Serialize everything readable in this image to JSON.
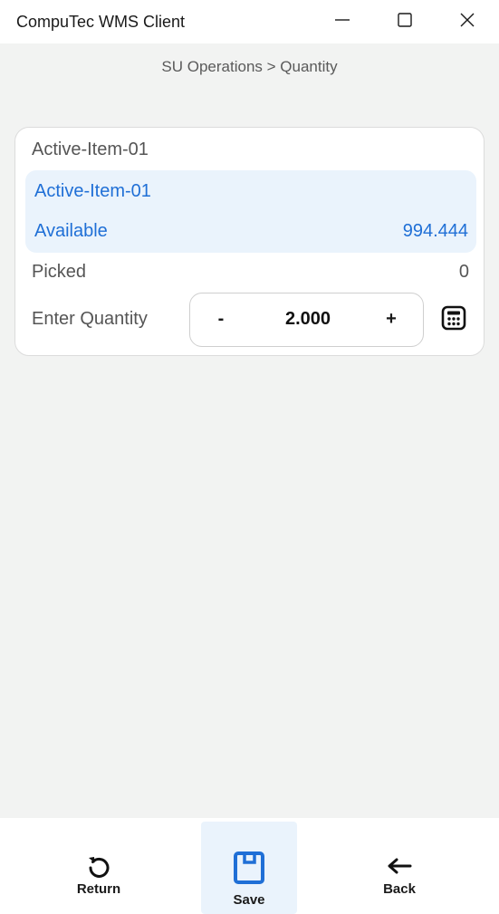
{
  "window": {
    "title": "CompuTec WMS Client"
  },
  "breadcrumb": "SU Operations > Quantity",
  "item": {
    "header": "Active-Item-01",
    "name": "Active-Item-01",
    "available_label": "Available",
    "available_value": "994.444",
    "picked_label": "Picked",
    "picked_value": "0",
    "quantity_label": "Enter Quantity",
    "quantity_value": "2.000",
    "minus_label": "-",
    "plus_label": "+"
  },
  "bottom_nav": {
    "return_label": "Return",
    "save_label": "Save",
    "back_label": "Back"
  },
  "colors": {
    "accent": "#1f6fd6",
    "highlight_bg": "#eaf3fc",
    "page_bg": "#f2f3f2"
  },
  "icons": {
    "minimize": "minimize-icon",
    "maximize": "maximize-icon",
    "close": "close-icon",
    "calculator": "calculator-icon",
    "return": "return-icon",
    "save": "save-icon",
    "back": "back-arrow-icon"
  }
}
